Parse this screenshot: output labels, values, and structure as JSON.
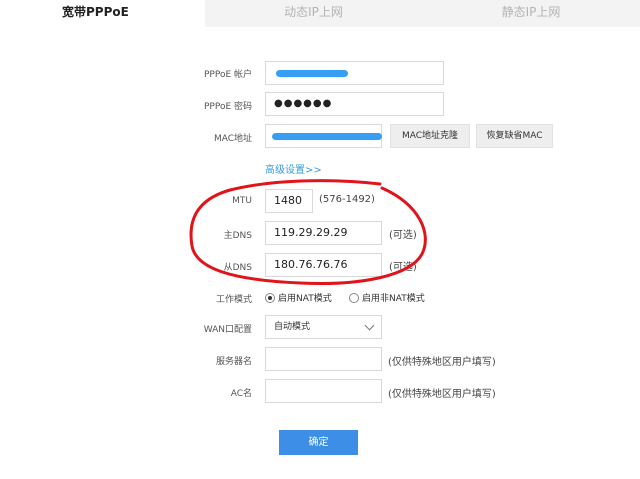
{
  "tabs": [
    {
      "label": "宽带PPPoE",
      "active": true
    },
    {
      "label": "动态IP上网",
      "active": false
    },
    {
      "label": "静态IP上网",
      "active": false
    }
  ],
  "form": {
    "pppoe_account_label": "PPPoE 帐户",
    "pppoe_password_label": "PPPoE 密码",
    "pppoe_password_value": "●●●●●●",
    "mac_label": "MAC地址",
    "mac_clone_button": "MAC地址克隆",
    "mac_restore_button": "恢复缺省MAC",
    "advanced_link": "高级设置>>",
    "mtu_label": "MTU",
    "mtu_value": "1480",
    "mtu_range": "(576-1492)",
    "primary_dns_label": "主DNS",
    "primary_dns_value": "119.29.29.29",
    "primary_dns_hint": "(可选)",
    "secondary_dns_label": "从DNS",
    "secondary_dns_value": "180.76.76.76",
    "secondary_dns_hint": "(可选)",
    "work_mode_label": "工作模式",
    "work_mode_options": [
      "启用NAT模式",
      "启用非NAT模式"
    ],
    "work_mode_selected": "启用NAT模式",
    "wan_port_label": "WAN口配置",
    "wan_port_value": "自动模式",
    "server_name_label": "服务器名",
    "server_name_hint": "(仅供特殊地区用户填写)",
    "ac_name_label": "AC名",
    "ac_name_hint": "(仅供特殊地区用户填写)",
    "confirm_button": "确定"
  },
  "colors": {
    "accent": "#3d8ee6",
    "link": "#3a9bdc",
    "annotation_red": "#e0141a",
    "redaction_blue": "#2b9af3"
  }
}
